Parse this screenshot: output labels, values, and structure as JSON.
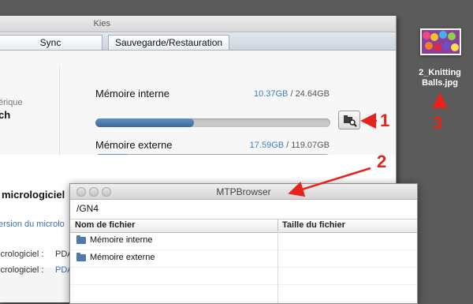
{
  "kies": {
    "title": "Kies",
    "tabs": [
      {
        "label": "Sync"
      },
      {
        "label": "Sauvegarde/Restauration"
      }
    ],
    "device_fragments": {
      "line1": "érique",
      "line2": "ch"
    },
    "storage": [
      {
        "label": "Mémoire interne",
        "used": "10.37GB",
        "total": "/ 24.64GB",
        "fill_fraction": 0.42
      },
      {
        "label": "Mémoire externe",
        "used": "17.59GB",
        "total": "/ 119.07GB",
        "fill_fraction": 0.148
      }
    ],
    "firmware": {
      "title": "micrologiciel",
      "link": "ersion du microlo",
      "row1_label": "icrologiciel :",
      "row1_value": "PDA",
      "row2_label": "icrologiciel :",
      "row2_value": "PDA"
    }
  },
  "mtp": {
    "title": "MTPBrowser",
    "path": "/GN4",
    "columns": [
      "Nom de fichier",
      "Taille du fichier"
    ],
    "rows": [
      {
        "name": "Mémoire interne",
        "size": ""
      },
      {
        "name": "Mémoire externe",
        "size": ""
      }
    ]
  },
  "desktop_file": {
    "name_line1": "2_Knitting",
    "name_line2": "Balls.jpg"
  },
  "annotations": {
    "n1": "1",
    "n2": "2",
    "n3": "3",
    "color": "#e8231c"
  }
}
